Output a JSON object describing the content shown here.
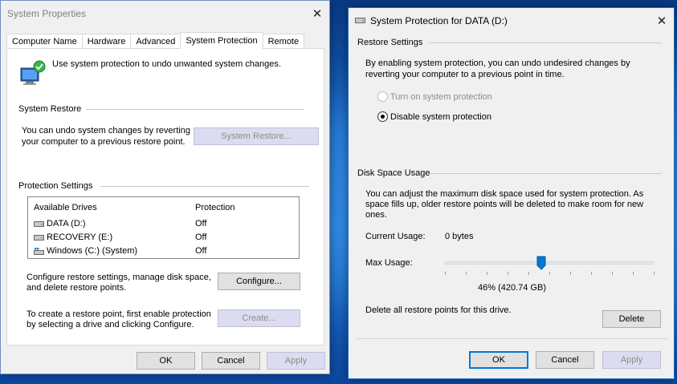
{
  "system_properties": {
    "title": "System Properties",
    "tabs": [
      "Computer Name",
      "Hardware",
      "Advanced",
      "System Protection",
      "Remote"
    ],
    "active_tab": "System Protection",
    "intro_text": "Use system protection to undo unwanted system changes.",
    "system_restore": {
      "section_label": "System Restore",
      "description_line1": "You can undo system changes by reverting",
      "description_line2": "your computer to a previous restore point.",
      "button_label": "System Restore..."
    },
    "protection_settings": {
      "section_label": "Protection Settings",
      "columns": [
        "Available Drives",
        "Protection"
      ],
      "drives": [
        {
          "name": "DATA (D:)",
          "protection": "Off",
          "icon": "drive-icon"
        },
        {
          "name": "RECOVERY (E:)",
          "protection": "Off",
          "icon": "drive-icon"
        },
        {
          "name": "Windows (C:) (System)",
          "protection": "Off",
          "icon": "system-drive-icon"
        }
      ],
      "configure_text_line1": "Configure restore settings, manage disk space,",
      "configure_text_line2": "and delete restore points.",
      "configure_button": "Configure...",
      "create_text_line1": "To create a restore point, first enable protection",
      "create_text_line2": "by selecting a drive and clicking Configure.",
      "create_button": "Create..."
    },
    "footer": {
      "ok": "OK",
      "cancel": "Cancel",
      "apply": "Apply"
    }
  },
  "system_protection": {
    "title": "System Protection for DATA (D:)",
    "restore_settings": {
      "section_label": "Restore Settings",
      "description_line1": "By enabling system protection, you can undo undesired changes by",
      "description_line2": "reverting your computer to a previous point in time.",
      "radio_on_label": "Turn on system protection",
      "radio_off_label": "Disable system protection",
      "selected": "off"
    },
    "disk_space": {
      "section_label": "Disk Space Usage",
      "description_line1": "You can adjust the maximum disk space used for system protection. As",
      "description_line2": "space fills up, older restore points will be deleted to make room for new",
      "description_line3": "ones.",
      "current_usage_label": "Current Usage:",
      "current_usage_value": "0 bytes",
      "max_usage_label": "Max Usage:",
      "max_usage_fraction": 0.46,
      "max_usage_display": "46% (420.74 GB)",
      "delete_text": "Delete all restore points for this drive.",
      "delete_button": "Delete"
    },
    "footer": {
      "ok": "OK",
      "cancel": "Cancel",
      "apply": "Apply"
    }
  }
}
